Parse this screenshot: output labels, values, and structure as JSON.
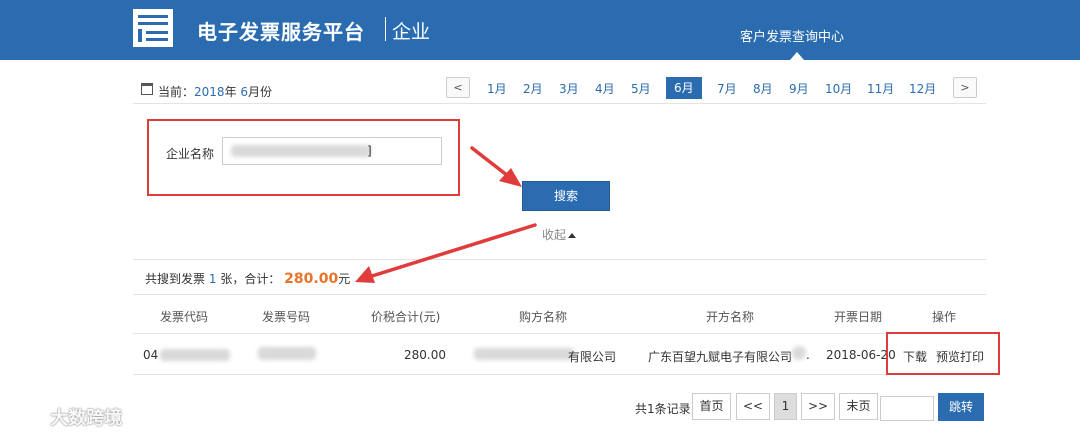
{
  "header": {
    "brand": "电子发票服务平台",
    "brand_sub": "企业",
    "nav_item": "客户发票查询中心"
  },
  "month_bar": {
    "current_prefix": "当前：",
    "year": "2018",
    "year_suffix": "年",
    "month": "6",
    "month_suffix": "月份",
    "prev_label": "<",
    "next_label": ">",
    "months": [
      "1月",
      "2月",
      "3月",
      "4月",
      "5月",
      "6月",
      "7月",
      "8月",
      "9月",
      "10月",
      "11月",
      "12月"
    ],
    "active_index": 5
  },
  "search": {
    "company_label": "企业名称",
    "company_value_suffix": "]",
    "search_button": "搜索",
    "collapse_label": "收起"
  },
  "summary": {
    "prefix": "共搜到发票",
    "count": "1",
    "middle": "张，合计：",
    "amount": "280.00",
    "unit": "元"
  },
  "table": {
    "headers": [
      "发票代码",
      "发票号码",
      "价税合计(元)",
      "购方名称",
      "开方名称",
      "开票日期",
      "操作"
    ],
    "row": {
      "code_prefix": "04",
      "amount": "280.00",
      "buyer_suffix": "有限公司",
      "seller": "广东百望九赋电子有限公司",
      "seller_suffix": ".",
      "date": "2018-06-20",
      "download": "下载",
      "preview": "预览打印"
    }
  },
  "pagination": {
    "total": "共1条记录",
    "first": "首页",
    "prev": "<<",
    "current": "1",
    "next": ">>",
    "last": "末页",
    "jump": "跳转"
  },
  "watermark": {
    "text": "大数跨境"
  },
  "colors": {
    "brand_blue": "#2b6cb1",
    "highlight_red": "#e03c3c",
    "amount_orange": "#e8742a"
  }
}
